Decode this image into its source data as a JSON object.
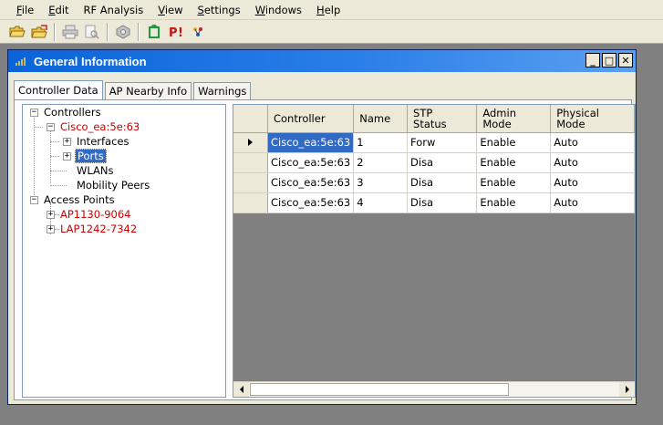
{
  "menu": [
    {
      "mnemonic": "F",
      "rest": "ile"
    },
    {
      "mnemonic": "E",
      "rest": "dit"
    },
    {
      "mnemonic": "",
      "rest": "RF Analysis"
    },
    {
      "mnemonic": "V",
      "rest": "iew"
    },
    {
      "mnemonic": "S",
      "rest": "ettings"
    },
    {
      "mnemonic": "W",
      "rest": "indows"
    },
    {
      "mnemonic": "H",
      "rest": "elp"
    }
  ],
  "toolbar_icons": [
    "open-folder-icon",
    "open-multi-icon",
    "print-icon",
    "print-preview-icon",
    "network-icon",
    "refresh-icon",
    "alert-icon",
    "tool-icon"
  ],
  "window": {
    "title": "General Information",
    "btn_min": "_",
    "btn_max": "□",
    "btn_close": "✕"
  },
  "tabs": [
    "Controller Data",
    "AP Nearby Info",
    "Warnings"
  ],
  "tree": {
    "controllers": "Controllers",
    "controller_name": "Cisco_ea:5e:63",
    "interfaces": "Interfaces",
    "ports": "Ports",
    "wlans": "WLANs",
    "mobility_peers": "Mobility Peers",
    "access_points": "Access Points",
    "ap1": "AP1130-9064",
    "ap2": "LAP1242-7342",
    "exp_minus": "−",
    "exp_plus": "+"
  },
  "grid": {
    "headers": [
      "Controller",
      "Name",
      "STP\nStatus",
      "Admin\nMode",
      "Physical\nMode"
    ],
    "header_lines": [
      [
        "Controller"
      ],
      [
        "Name"
      ],
      [
        "STP",
        "Status"
      ],
      [
        "Admin",
        "Mode"
      ],
      [
        "Physical",
        "Mode"
      ]
    ],
    "rows": [
      [
        "Cisco_ea:5e:63",
        "1",
        "Forw",
        "Enable",
        "Auto"
      ],
      [
        "Cisco_ea:5e:63",
        "2",
        "Disa",
        "Enable",
        "Auto"
      ],
      [
        "Cisco_ea:5e:63",
        "3",
        "Disa",
        "Enable",
        "Auto"
      ],
      [
        "Cisco_ea:5e:63",
        "4",
        "Disa",
        "Enable",
        "Auto"
      ]
    ]
  },
  "colors": {
    "title_bar": "#0a64d8",
    "selection": "#316ac5",
    "tree_red": "#cc0000",
    "workspace": "#808080"
  }
}
